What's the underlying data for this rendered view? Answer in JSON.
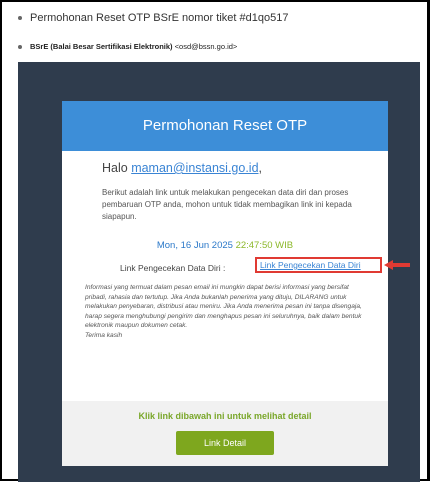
{
  "email": {
    "subject": "Permohonan Reset OTP BSrE nomor tiket #d1qo517",
    "sender_name": "BSrE (Balai Besar Sertifikasi Elektronik)",
    "sender_email": "<osd@bssn.go.id>"
  },
  "card": {
    "title": "Permohonan Reset OTP",
    "greeting_prefix": "Halo ",
    "greeting_email": "maman@instansi.go.id",
    "greeting_suffix": ",",
    "paragraph": "Berikut adalah link untuk melakukan pengecekan data diri dan proses pembaruan OTP anda, mohon untuk tidak membagikan link ini kepada siapapun.",
    "date": "Mon, 16 Jun 2025",
    "time": "22:47:50 WIB",
    "link_label": "Link Pengecekan Data Diri : ",
    "link_text": "Link Pengecekan Data Diri",
    "disclaimer": "Informasi yang termuat dalam pesan email ini mungkin dapat berisi informasi yang bersifat pribadi, rahasia dan tertutup. Jika Anda bukanlah penerima yang dituju, DILARANG untuk melakukan penyebaran, distribusi atau meniru. Jika Anda menerima pesan ini tanpa disengaja, harap segera menghubungi pengirim dan menghapus pesan ini seluruhnya, baik dalam bentuk elektronik maupun dokumen cetak.",
    "closing": "Terima kasih",
    "footer_text": "Klik link dibawah ini untuk melihat detail",
    "detail_button": "Link Detail"
  },
  "colors": {
    "header_blue": "#3d8ed8",
    "background_dark": "#2f3c4d",
    "highlight_red": "#e03a33",
    "button_green": "#7ea71e"
  }
}
